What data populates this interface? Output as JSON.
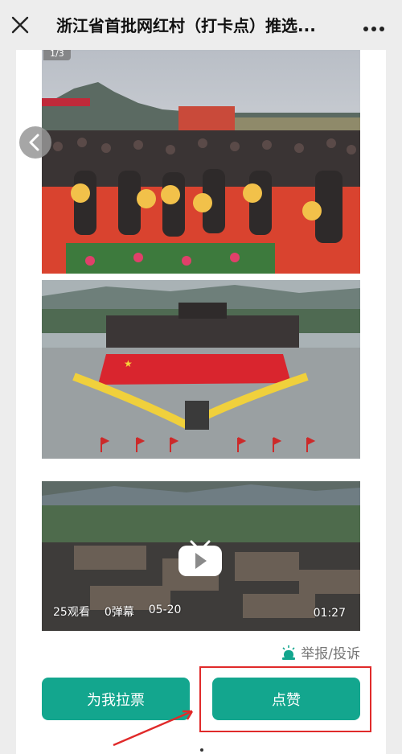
{
  "header": {
    "title": "浙江省首批网红村（打卡点）推选...",
    "close_icon": "close-icon",
    "more_icon": "more-icon"
  },
  "gallery": {
    "page_tag": "1/3",
    "prev_icon": "chevron-left-icon"
  },
  "video": {
    "views": "25观看",
    "danmaku": "0弹幕",
    "date": "05-20",
    "duration": "01:27",
    "play_icon": "play-icon"
  },
  "report": {
    "label": "举报/投诉",
    "icon": "report-icon"
  },
  "actions": {
    "vote_label": "为我拉票",
    "like_label": "点赞"
  },
  "colors": {
    "accent": "#13a68e",
    "annotation": "#e02a2a"
  }
}
